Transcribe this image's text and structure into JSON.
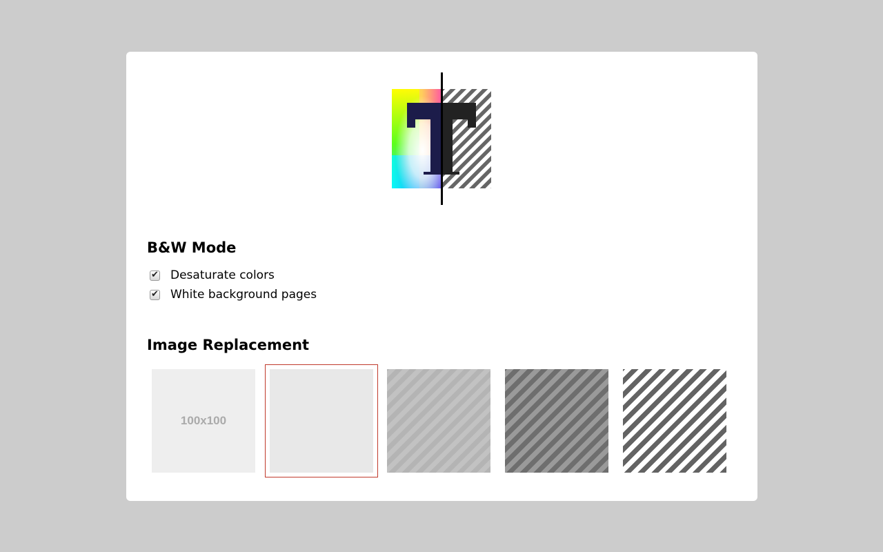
{
  "logo": {
    "name": "bw-mode-logo",
    "glyph": "T",
    "colors": {
      "glyph_left": "#1c1c4a",
      "glyph_right": "#222222",
      "stripe": "#666666",
      "divider": "#000000"
    }
  },
  "bw_mode": {
    "title": "B&W Mode",
    "options": [
      {
        "label": "Desaturate colors",
        "checked": true
      },
      {
        "label": "White background pages",
        "checked": true
      }
    ]
  },
  "image_replacement": {
    "title": "Image Replacement",
    "selected_index": 1,
    "options": [
      {
        "id": "placeholder",
        "text": "100x100",
        "icon": "placeholder-image-icon"
      },
      {
        "id": "light-gray",
        "text": "",
        "icon": "solid-light-gray"
      },
      {
        "id": "light-stripes",
        "text": "",
        "icon": "light-stripes"
      },
      {
        "id": "dark-stripes",
        "text": "",
        "icon": "dark-stripes"
      },
      {
        "id": "bw-stripes",
        "text": "",
        "icon": "black-white-stripes"
      }
    ],
    "selection_color": "#c0392b"
  },
  "colors": {
    "background": "#cccccc",
    "panel": "#ffffff"
  }
}
